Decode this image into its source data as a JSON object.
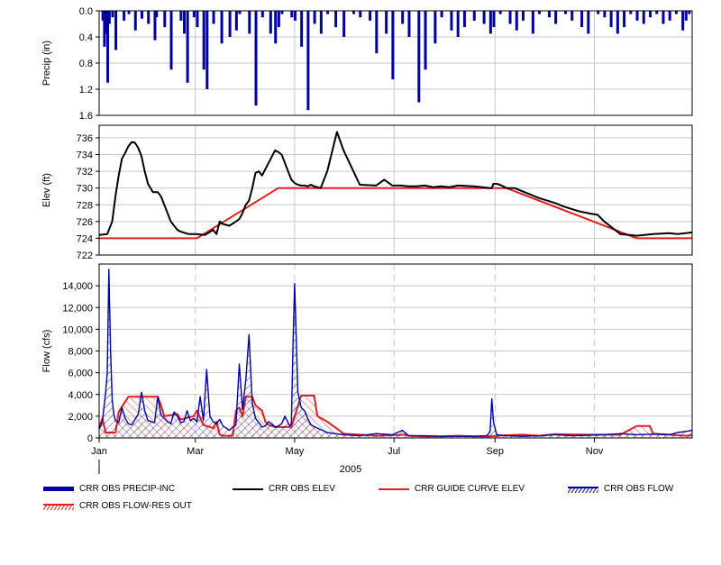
{
  "chart_data": [
    {
      "type": "bar",
      "ylabel": "Precip (in)",
      "ylim": [
        0,
        1.6
      ],
      "y_inverted": true,
      "yticks": [
        "0.0",
        "0.4",
        "0.8",
        "1.2",
        "1.6"
      ],
      "ytick_values": [
        0,
        0.4,
        0.8,
        1.2,
        1.6
      ],
      "grid": true,
      "series": [
        {
          "name": "CRR OBS PRECIP-INC",
          "color": "#0000a0",
          "x": [
            2,
            3,
            4,
            5,
            6,
            8,
            10,
            15,
            18,
            22,
            26,
            30,
            34,
            35,
            40,
            44,
            50,
            52,
            54,
            58,
            60,
            64,
            66,
            70,
            75,
            80,
            84,
            86,
            92,
            96,
            100,
            105,
            108,
            110,
            112,
            118,
            120,
            124,
            128,
            132,
            136,
            140,
            145,
            150,
            156,
            160,
            166,
            170,
            176,
            180,
            186,
            190,
            196,
            200,
            206,
            210,
            216,
            220,
            224,
            230,
            236,
            240,
            242,
            246,
            252,
            256,
            260,
            266,
            270,
            276,
            280,
            286,
            290,
            296,
            300,
            306,
            310,
            314,
            318,
            322,
            326,
            330,
            334,
            338,
            342,
            346,
            350,
            354,
            358,
            360,
            362
          ],
          "values": [
            0.15,
            0.55,
            0.35,
            1.1,
            0.2,
            0.1,
            0.6,
            0.15,
            0.05,
            0.3,
            0.12,
            0.2,
            0.45,
            0.1,
            0.25,
            0.9,
            0.15,
            0.35,
            1.1,
            0.1,
            0.25,
            0.9,
            1.2,
            0.2,
            0.5,
            0.4,
            0.3,
            0.05,
            0.35,
            1.45,
            0.1,
            0.35,
            0.5,
            0.25,
            0.05,
            0.1,
            0.15,
            0.55,
            1.52,
            0.2,
            0.35,
            0.05,
            0.25,
            0.4,
            0.05,
            0.1,
            0.15,
            0.65,
            0.35,
            1.05,
            0.2,
            0.4,
            1.4,
            0.9,
            0.5,
            0.1,
            0.3,
            0.4,
            0.25,
            0.15,
            0.2,
            0.35,
            0.25,
            0.05,
            0.2,
            0.3,
            0.15,
            0.35,
            0.05,
            0.1,
            0.2,
            0.05,
            0.15,
            0.25,
            0.35,
            0.05,
            0.1,
            0.25,
            0.35,
            0.25,
            0.05,
            0.15,
            0.2,
            0.1,
            0.05,
            0.2,
            0.15,
            0.05,
            0.3,
            0.15,
            0.05
          ]
        }
      ]
    },
    {
      "type": "line",
      "ylabel": "Elev (ft)",
      "ylim": [
        722,
        737.5
      ],
      "yticks": [
        "722",
        "724",
        "726",
        "728",
        "730",
        "732",
        "734",
        "736"
      ],
      "ytick_values": [
        722,
        724,
        726,
        728,
        730,
        732,
        734,
        736
      ],
      "grid": true,
      "series": [
        {
          "name": "CRR OBS ELEV",
          "color": "#000000",
          "x": [
            0,
            5,
            8,
            10,
            12,
            14,
            16,
            18,
            20,
            22,
            24,
            26,
            28,
            30,
            33,
            36,
            38,
            40,
            42,
            44,
            46,
            48,
            50,
            55,
            60,
            65,
            70,
            72,
            74,
            76,
            80,
            84,
            86,
            88,
            90,
            92,
            94,
            96,
            98,
            100,
            104,
            108,
            110,
            112,
            114,
            116,
            118,
            120,
            122,
            124,
            126,
            128,
            130,
            132,
            136,
            140,
            146,
            150,
            160,
            170,
            175,
            180,
            185,
            190,
            195,
            200,
            205,
            210,
            215,
            220,
            230,
            240,
            241,
            242,
            244,
            246,
            248,
            250,
            255,
            260,
            265,
            270,
            275,
            280,
            285,
            290,
            295,
            300,
            303,
            306,
            310,
            320,
            330,
            340,
            350,
            355,
            360,
            364
          ],
          "values": [
            724.4,
            724.5,
            726,
            729,
            731.5,
            733.5,
            734.2,
            735,
            735.5,
            735.4,
            734.8,
            733.8,
            732,
            730.5,
            729.5,
            729.5,
            729,
            728,
            727,
            726,
            725.5,
            725,
            724.8,
            724.5,
            724.5,
            724.4,
            725,
            724.5,
            726,
            725.7,
            725.5,
            726,
            726.3,
            727,
            728,
            728.5,
            730,
            731.8,
            732,
            731.5,
            733,
            734.5,
            734.3,
            734,
            733,
            732,
            731,
            730.6,
            730.4,
            730.3,
            730.3,
            730.2,
            730.4,
            730.2,
            730,
            732,
            736.7,
            734.5,
            730.4,
            730.3,
            731,
            730.3,
            730.3,
            730.2,
            730.2,
            730.3,
            730.1,
            730.2,
            730.1,
            730.3,
            730.2,
            730,
            730,
            730.5,
            730.5,
            730.4,
            730.2,
            730,
            730,
            729.6,
            729.2,
            728.8,
            728.5,
            728.2,
            727.8,
            727.5,
            727.2,
            727,
            726.9,
            726.8,
            726,
            724.5,
            724.3,
            724.5,
            724.6,
            724.5,
            724.6,
            724.7
          ]
        },
        {
          "name": "CRR GUIDE CURVE ELEV",
          "color": "#e02020",
          "x": [
            0,
            60,
            110,
            130,
            240,
            250,
            330,
            364
          ],
          "values": [
            724,
            724,
            730,
            730,
            730,
            730,
            724,
            724
          ]
        }
      ]
    },
    {
      "type": "area",
      "ylabel": "Flow (cfs)",
      "xlabel": "2005",
      "ylim": [
        0,
        16000
      ],
      "yticks": [
        "0",
        "2,000",
        "4,000",
        "6,000",
        "8,000",
        "10,000",
        "12,000",
        "14,000"
      ],
      "ytick_values": [
        0,
        2000,
        4000,
        6000,
        8000,
        10000,
        12000,
        14000
      ],
      "x_tick_labels": [
        "Jan",
        "Mar",
        "May",
        "Jul",
        "Sep",
        "Nov"
      ],
      "x_tick_values": [
        0,
        59,
        120,
        181,
        243,
        304
      ],
      "grid": true,
      "series": [
        {
          "name": "CRR OBS FLOW",
          "color": "#0000a0",
          "x": [
            0,
            2,
            4,
            5,
            6,
            7,
            8,
            9,
            10,
            12,
            14,
            16,
            18,
            20,
            24,
            26,
            28,
            30,
            34,
            36,
            38,
            40,
            42,
            44,
            46,
            48,
            50,
            52,
            54,
            56,
            58,
            60,
            62,
            64,
            66,
            68,
            70,
            72,
            74,
            76,
            78,
            80,
            82,
            84,
            86,
            88,
            90,
            92,
            94,
            96,
            98,
            100,
            102,
            104,
            106,
            108,
            110,
            112,
            114,
            116,
            117,
            118,
            119,
            120,
            121,
            122,
            124,
            126,
            128,
            130,
            134,
            140,
            150,
            160,
            170,
            180,
            186,
            190,
            200,
            210,
            220,
            230,
            238,
            240,
            241,
            242,
            244,
            250,
            260,
            270,
            280,
            290,
            300,
            310,
            320,
            330,
            340,
            350,
            355,
            360,
            364
          ],
          "values": [
            800,
            1500,
            4200,
            6000,
            15500,
            8000,
            3500,
            2200,
            1600,
            1400,
            2800,
            1800,
            1300,
            1200,
            2200,
            4200,
            2500,
            1600,
            1400,
            3800,
            2100,
            1800,
            1500,
            1300,
            2400,
            2000,
            1400,
            1500,
            2500,
            1600,
            1800,
            1500,
            3800,
            1600,
            6300,
            2000,
            1500,
            1300,
            1700,
            1100,
            900,
            700,
            1000,
            1200,
            6800,
            2600,
            5300,
            9500,
            3200,
            1800,
            1400,
            1000,
            1100,
            1500,
            1300,
            1000,
            1100,
            1300,
            2000,
            1400,
            1100,
            1300,
            8500,
            14200,
            9200,
            4200,
            2800,
            2500,
            1800,
            1200,
            900,
            500,
            300,
            200,
            400,
            300,
            700,
            200,
            200,
            150,
            150,
            150,
            200,
            600,
            3600,
            1500,
            300,
            200,
            150,
            200,
            300,
            200,
            250,
            300,
            400,
            300,
            350,
            300,
            500,
            600,
            700
          ]
        },
        {
          "name": "CRR OBS FLOW-RES OUT",
          "color": "#e02020",
          "x": [
            0,
            2,
            4,
            10,
            12,
            18,
            20,
            36,
            38,
            40,
            48,
            50,
            58,
            60,
            64,
            68,
            70,
            72,
            74,
            76,
            82,
            84,
            86,
            88,
            90,
            94,
            96,
            100,
            102,
            104,
            108,
            118,
            120,
            124,
            132,
            134,
            140,
            150,
            160,
            170,
            180,
            188,
            190,
            200,
            210,
            220,
            230,
            240,
            250,
            260,
            270,
            280,
            300,
            320,
            330,
            338,
            340,
            350,
            360,
            364
          ],
          "values": [
            1000,
            1800,
            500,
            500,
            2400,
            3800,
            3800,
            3800,
            3000,
            2000,
            2200,
            1700,
            2000,
            2500,
            1200,
            1000,
            900,
            1500,
            300,
            200,
            200,
            2500,
            2800,
            2000,
            3800,
            3800,
            3000,
            2500,
            1500,
            1200,
            1000,
            1000,
            2000,
            3900,
            3900,
            2000,
            1500,
            400,
            300,
            200,
            250,
            300,
            200,
            150,
            150,
            200,
            150,
            150,
            250,
            300,
            200,
            350,
            300,
            300,
            1100,
            1100,
            400,
            300,
            200,
            250
          ]
        }
      ]
    }
  ],
  "legend": [
    {
      "label": "CRR OBS PRECIP-INC",
      "kind": "thick",
      "color": "#0000a0"
    },
    {
      "label": "CRR OBS ELEV",
      "kind": "line",
      "color": "#000000"
    },
    {
      "label": "CRR GUIDE CURVE ELEV",
      "kind": "line",
      "color": "#e02020"
    },
    {
      "label": "CRR OBS FLOW",
      "kind": "hatch",
      "color": "#0000a0"
    },
    {
      "label": "CRR OBS FLOW-RES OUT",
      "kind": "hatch",
      "color": "#e02020"
    }
  ]
}
